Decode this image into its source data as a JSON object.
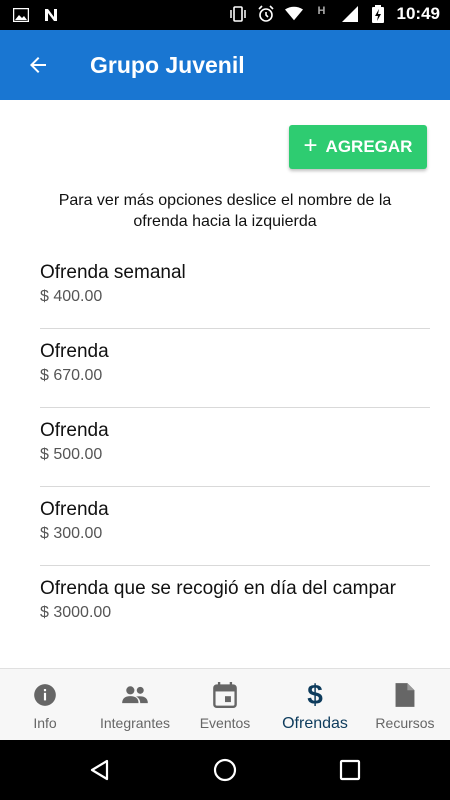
{
  "status_bar": {
    "time": "10:49",
    "h_indicator": "H"
  },
  "app_bar": {
    "title": "Grupo Juvenil"
  },
  "content": {
    "add_button_label": "AGREGAR",
    "hint": "Para ver más opciones deslice el nombre de la ofrenda hacia la izquierda",
    "items": [
      {
        "title": "Ofrenda semanal",
        "amount": "$ 400.00"
      },
      {
        "title": "Ofrenda",
        "amount": "$ 670.00"
      },
      {
        "title": "Ofrenda",
        "amount": "$ 500.00"
      },
      {
        "title": "Ofrenda",
        "amount": "$ 300.00"
      },
      {
        "title": "Ofrenda que se recogió en día del campar",
        "amount": "$ 3000.00"
      }
    ]
  },
  "bottom_nav": {
    "items": [
      {
        "label": "Info",
        "icon": "info-icon"
      },
      {
        "label": "Integrantes",
        "icon": "people-icon"
      },
      {
        "label": "Eventos",
        "icon": "calendar-icon"
      },
      {
        "label": "Ofrendas",
        "icon": "dollar-icon",
        "active": true
      },
      {
        "label": "Recursos",
        "icon": "document-icon"
      }
    ],
    "dollar_glyph": "$"
  },
  "colors": {
    "app_bar": "#1976d2",
    "add_button": "#2ecc71",
    "active_nav": "#0d3b5c"
  }
}
